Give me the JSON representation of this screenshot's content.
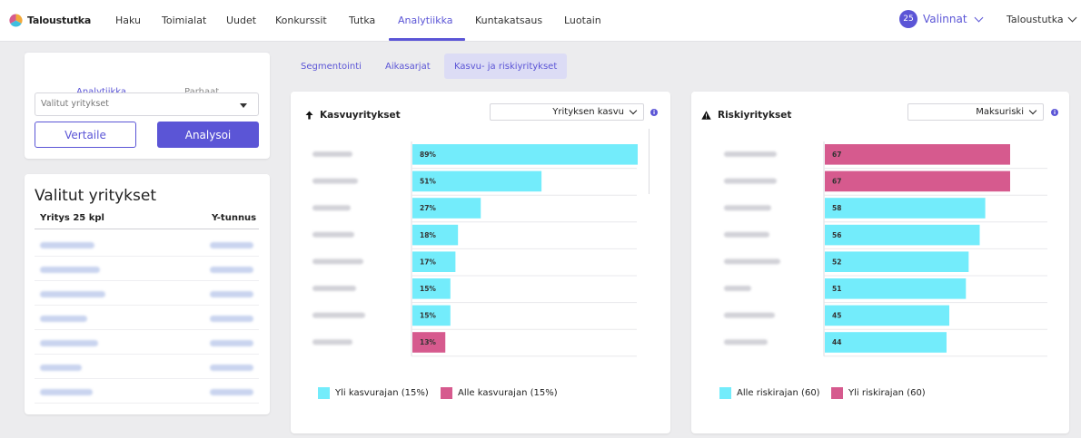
{
  "app": {
    "brand": "Taloustutka"
  },
  "nav": {
    "items": [
      "Haku",
      "Toimialat",
      "Uudet",
      "Konkurssit",
      "Tutka",
      "Analytiikka",
      "Kuntakatsaus",
      "Luotain"
    ],
    "active": "Analytiikka",
    "selections_count": "25",
    "selections_label": "Valinnat",
    "account_label": "Taloustutka"
  },
  "sidebar": {
    "tabs": [
      "Analytiikka",
      "Parhaat"
    ],
    "active_tab": "Analytiikka",
    "select_placeholder": "Valitut yritykset",
    "compare_button": "Vertaile",
    "analyze_button": "Analysoi",
    "list_title": "Valitut yritykset",
    "col_company": "Yritys 25 kpl",
    "col_id": "Y-tunnus"
  },
  "subtabs": {
    "items": [
      "Segmentointi",
      "Aikasarjat",
      "Kasvu- ja riskiyritykset"
    ],
    "active": "Kasvu- ja riskiyritykset"
  },
  "growth": {
    "title": "Kasvuyritykset",
    "selector": "Yrityksen kasvu",
    "legend_above": "Yli kasvurajan (15%)",
    "legend_below": "Alle kasvurajan (15%)"
  },
  "risk": {
    "title": "Riskiyritykset",
    "selector": "Maksuriski",
    "legend_below": "Alle riskirajan (60)",
    "legend_above": "Yli riskirajan (60)"
  },
  "colors": {
    "accent": "#5b55d6",
    "cyan": "#73ecfb",
    "pink": "#d65a8e"
  },
  "chart_data": [
    {
      "type": "bar",
      "orientation": "horizontal",
      "title": "Kasvuyritykset",
      "values": [
        89,
        51,
        27,
        18,
        17,
        15,
        15,
        13
      ],
      "labels": [
        "89%",
        "51%",
        "27%",
        "18%",
        "17%",
        "15%",
        "15%",
        "13%"
      ],
      "threshold": 15,
      "series": [
        {
          "name": "Yli kasvurajan (15%)",
          "color": "#73ecfb"
        },
        {
          "name": "Alle kasvurajan (15%)",
          "color": "#d65a8e"
        }
      ],
      "legend": "bottom"
    },
    {
      "type": "bar",
      "orientation": "horizontal",
      "title": "Riskiyritykset",
      "values": [
        67,
        67,
        58,
        56,
        52,
        51,
        45,
        44
      ],
      "labels": [
        "67",
        "67",
        "58",
        "56",
        "52",
        "51",
        "45",
        "44"
      ],
      "threshold": 60,
      "series": [
        {
          "name": "Alle riskirajan (60)",
          "color": "#73ecfb"
        },
        {
          "name": "Yli riskirajan (60)",
          "color": "#d65a8e"
        }
      ],
      "legend": "bottom"
    }
  ]
}
